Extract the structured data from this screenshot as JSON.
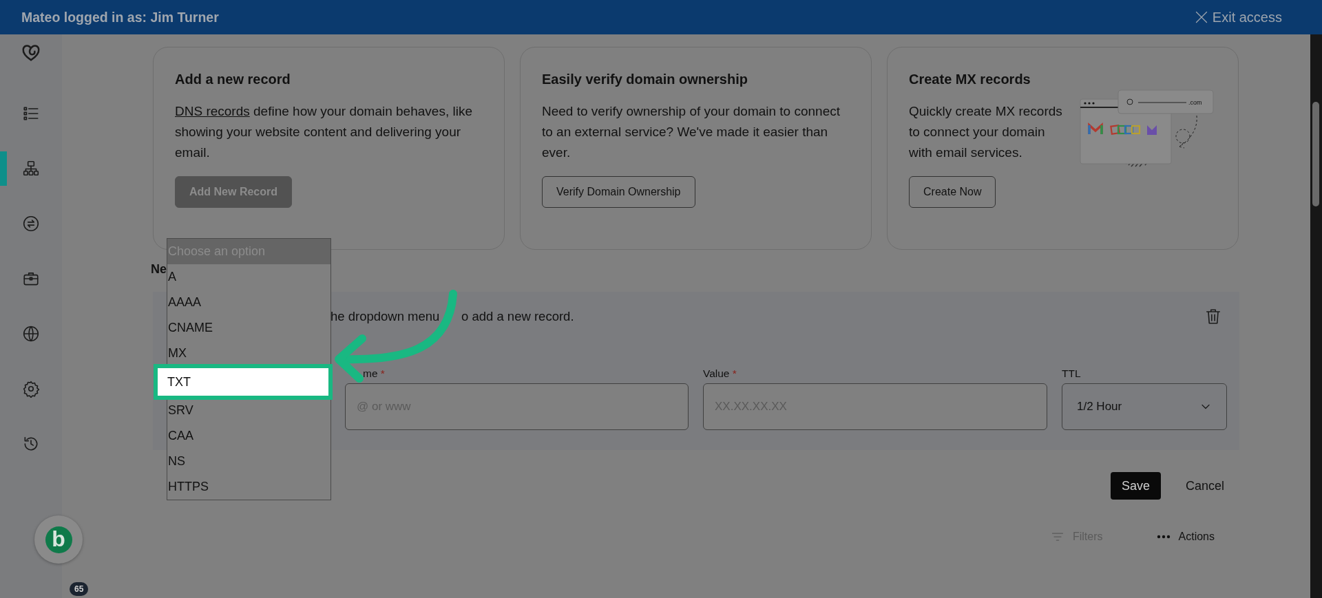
{
  "top_bar": {
    "impersonation": "Mateo logged in as: Jim Turner",
    "exit": "Exit access"
  },
  "sidebar": {
    "items": [
      {
        "kind": "list",
        "selected": false
      },
      {
        "kind": "hierarchy",
        "selected": true
      },
      {
        "kind": "transfer",
        "selected": false
      },
      {
        "kind": "briefcase",
        "selected": false
      },
      {
        "kind": "globe",
        "selected": false
      },
      {
        "kind": "gear",
        "selected": false
      },
      {
        "kind": "history",
        "selected": false
      }
    ]
  },
  "cards": [
    {
      "title": "Add a new record",
      "link": "DNS records",
      "text": " define how your domain behaves, like showing your website content and delivering your email.",
      "button": "Add New Record",
      "disabled": true
    },
    {
      "title": "Easily verify domain ownership",
      "text": "Need to verify ownership of your domain to connect to an external service? We've made it easier than ever.",
      "button": "Verify Domain Ownership",
      "disabled": false
    },
    {
      "title": "Create MX records",
      "text": "Quickly create MX records to connect your domain with email services.",
      "button": "Create Now",
      "disabled": false,
      "illustration_label": ".com"
    }
  ],
  "section_title": "Ne",
  "new_record": {
    "instruction": [
      "he dropdown menu",
      "o add a new record."
    ],
    "required_mark": "*",
    "fields": [
      {
        "kind": "text",
        "label": "me",
        "required": true,
        "placeholder": "@ or www"
      },
      {
        "kind": "text",
        "label": "Value",
        "required": true,
        "placeholder": "XX.XX.XX.XX"
      },
      {
        "kind": "select",
        "label": "TTL",
        "required": false,
        "value": "1/2 Hour"
      }
    ]
  },
  "actions": {
    "save": "Save",
    "cancel": "Cancel"
  },
  "toolbar": {
    "filters": "Filters",
    "filters_disabled": true,
    "actions": "Actions"
  },
  "dropdown": {
    "placeholder": "Choose an option",
    "options": [
      {
        "label": "A",
        "selected": false
      },
      {
        "label": "AAAA",
        "selected": false
      },
      {
        "label": "CNAME",
        "selected": false
      },
      {
        "label": "MX",
        "selected": false
      },
      {
        "label": "TXT",
        "selected": true
      },
      {
        "label": "SRV",
        "selected": false
      },
      {
        "label": "CAA",
        "selected": false
      },
      {
        "label": "NS",
        "selected": false
      },
      {
        "label": "HTTPS",
        "selected": false
      }
    ]
  },
  "avatar": {
    "letter": "b",
    "badge": "65"
  }
}
